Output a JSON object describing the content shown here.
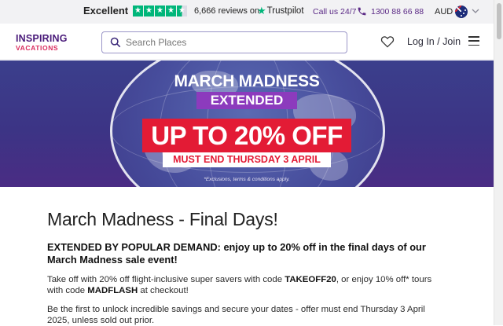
{
  "trustbar": {
    "rating_word": "Excellent",
    "review_count": "6,666",
    "reviews_suffix": "reviews on",
    "trustpilot_label": "Trustpilot",
    "stars_filled": 4.5,
    "call_label": "Call us 24/7",
    "phone": "1300 88 66 88",
    "currency": "AUD",
    "colors": {
      "trustpilot_green": "#00b67a",
      "phone_purple": "#5b2a86"
    }
  },
  "header": {
    "logo_line1": "INSPIRING",
    "logo_line2": "VACATIONS",
    "search_placeholder": "Search Places",
    "login_label": "Log In / Join"
  },
  "hero": {
    "title": "MARCH MADNESS",
    "subtitle": "EXTENDED",
    "offer": "UP TO 20% OFF",
    "deadline": "MUST END THURSDAY 3 APRIL",
    "fine_print": "*Exclusions, terms & conditions apply.",
    "colors": {
      "offer_red": "#e31b35",
      "extended_purple": "#8c3bbd"
    }
  },
  "content": {
    "page_title": "March Madness - Final Days!",
    "lead": "EXTENDED BY POPULAR DEMAND: enjoy up to 20% off in the final days of our March Madness sale event!",
    "para1": {
      "part1": "Take off with 20% off flight-inclusive super savers with code ",
      "code1": "TAKEOFF20",
      "part2": ", or enjoy 10% off* tours with code ",
      "code2": "MADFLASH",
      "part3": " at checkout!"
    },
    "para2": "Be the first to unlock incredible savings and secure your dates - offer must end Thursday 3 April 2025, unless sold out prior."
  }
}
